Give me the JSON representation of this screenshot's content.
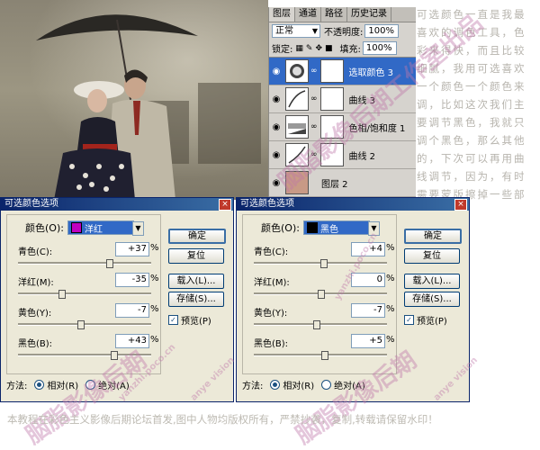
{
  "layers_panel": {
    "tabs": [
      "图层",
      "通道",
      "路径",
      "历史记录"
    ],
    "blend_mode": "正常",
    "opacity_label": "不透明度:",
    "opacity_value": "100%",
    "lock_label": "锁定:",
    "fill_label": "填充:",
    "fill_value": "100%",
    "layers": [
      {
        "name": "选取颜色 3",
        "active": true,
        "thumb": "selective-color-adjustment"
      },
      {
        "name": "曲线 3",
        "active": false,
        "thumb": "curves-adjustment"
      },
      {
        "name": "色相/饱和度 1",
        "active": false,
        "thumb": "hue-saturation-adjustment"
      },
      {
        "name": "曲线 2",
        "active": false,
        "thumb": "curves-adjustment"
      },
      {
        "name": "图层 2",
        "active": false,
        "thumb": "color-fill",
        "color": "#c89a86"
      }
    ]
  },
  "side_text": "可选颜色一直是我最喜欢的调色工具，色彩来得快，而且比较细腻，我用可选喜欢一个颜色一个颜色来调，比如这次我们主要调节黑色，我就只调个黑色，那么其他的，下次可以再用曲线调节，因为，有时需要蒙版擦掉一些部位的颜色",
  "dialogs": [
    {
      "title": "可选颜色选项",
      "color_label": "颜色(O):",
      "color_name": "洋红",
      "color_swatch": "#c000c0",
      "sliders": [
        {
          "label": "青色(C):",
          "value": "+37",
          "level": 37
        },
        {
          "label": "洋红(M):",
          "value": "-35",
          "level": -35
        },
        {
          "label": "黄色(Y):",
          "value": "-7",
          "level": -7
        },
        {
          "label": "黑色(B):",
          "value": "+43",
          "level": 43
        }
      ],
      "buttons": [
        "确定",
        "复位",
        "载入(L)...",
        "存储(S)..."
      ],
      "preview_label": "预览(P)",
      "preview_checked": true,
      "method_label": "方法:",
      "method_options": [
        "相对(R)",
        "绝对(A)"
      ],
      "method_selected": 0
    },
    {
      "title": "可选颜色选项",
      "color_label": "颜色(O):",
      "color_name": "黑色",
      "color_swatch": "#000000",
      "sliders": [
        {
          "label": "青色(C):",
          "value": "+4",
          "level": 4
        },
        {
          "label": "洋红(M):",
          "value": "0",
          "level": 0
        },
        {
          "label": "黄色(Y):",
          "value": "-7",
          "level": -7
        },
        {
          "label": "黑色(B):",
          "value": "+5",
          "level": 5
        }
      ],
      "buttons": [
        "确定",
        "复位",
        "载入(L)...",
        "存储(S)..."
      ],
      "preview_label": "预览(P)",
      "preview_checked": true,
      "method_label": "方法:",
      "method_options": [
        "相对(R)",
        "绝对(A)"
      ],
      "method_selected": 0
    }
  ],
  "percent_sign": "%",
  "footer": "本教程在彩色主义影像后期论坛首发,图中人物均版权所有，严禁抄袭，复制,转载请保留水印！",
  "watermarks": [
    "胭脂影像后期工作室出品",
    "胭脂影像后期",
    "yanzhi.poco.cn",
    "anye vision"
  ]
}
